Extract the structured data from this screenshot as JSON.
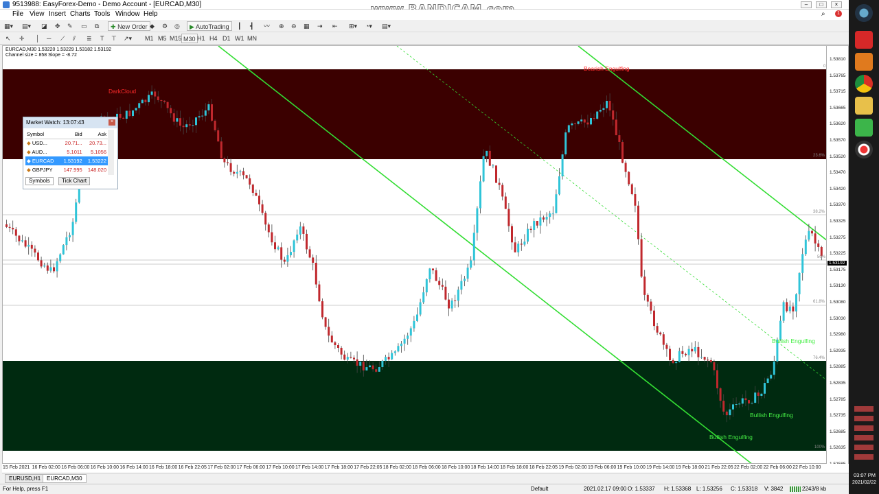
{
  "window": {
    "title": "9513988: EasyForex-Demo - Demo Account - [EURCAD,M30]",
    "watermark": "www.BANDICAM.com"
  },
  "menu": [
    "File",
    "View",
    "Insert",
    "Charts",
    "Tools",
    "Window",
    "Help"
  ],
  "toolbar": {
    "new_order": "New Order",
    "autotrading": "AutoTrading",
    "timeframes": [
      "M1",
      "M5",
      "M15",
      "M30",
      "H1",
      "H4",
      "D1",
      "W1",
      "MN"
    ]
  },
  "chart": {
    "header_line1": "EURCAD,M30  1.53220 1.53229 1.53182 1.53192",
    "header_line2": "Channel size = 858 Slope = -8.72",
    "price_labels": [
      "1.53810",
      "1.53765",
      "1.53715",
      "1.53665",
      "1.53620",
      "1.53570",
      "1.53520",
      "1.53470",
      "1.53420",
      "1.53370",
      "1.53325",
      "1.53275",
      "1.53225",
      "1.53175",
      "1.53130",
      "1.53080",
      "1.53030",
      "1.52980",
      "1.52935",
      "1.52885",
      "1.52835",
      "1.52785",
      "1.52735",
      "1.52685",
      "1.52635",
      "1.52585"
    ],
    "current_price": "1.53192",
    "fib_labels": {
      "f0": "0",
      "f236": "23.6%",
      "f382": "38.2%",
      "f50": "50%",
      "f618": "61.8%",
      "f764": "76.4%",
      "f100": "100%"
    },
    "time_labels": [
      "15 Feb 2021",
      "16 Feb 02:00",
      "16 Feb 06:00",
      "16 Feb 10:00",
      "16 Feb 14:00",
      "16 Feb 18:00",
      "16 Feb 22:05",
      "17 Feb 02:00",
      "17 Feb 06:00",
      "17 Feb 10:00",
      "17 Feb 14:00",
      "17 Feb 18:00",
      "17 Feb 22:05",
      "18 Feb 02:00",
      "18 Feb 06:00",
      "18 Feb 10:00",
      "18 Feb 14:00",
      "18 Feb 18:00",
      "18 Feb 22:05",
      "19 Feb 02:00",
      "19 Feb 06:00",
      "19 Feb 10:00",
      "19 Feb 14:00",
      "19 Feb 18:00",
      "21 Feb 22:05",
      "22 Feb 02:00",
      "22 Feb 06:00",
      "22 Feb 10:00"
    ],
    "annotations": {
      "dark_cloud": "DarkCloud",
      "bearish": "Bearish Engulfing",
      "bullish1": "Bullish Engulfing",
      "bullish2": "Bullish Engulfing",
      "bullish3": "Bullish Engulfing"
    },
    "colors": {
      "bull": "#2fc4d8",
      "bear": "#c0282d",
      "supply_zone": "#3b0000",
      "demand_zone": "#002a10",
      "channel": "#33dd33"
    }
  },
  "market_watch": {
    "title": "Market Watch: 13:07:43",
    "columns": [
      "Symbol",
      "Bid",
      "Ask"
    ],
    "rows": [
      {
        "symbol": "USD...",
        "bid": "20.71...",
        "ask": "20.73..."
      },
      {
        "symbol": "AUD...",
        "bid": "5.1011",
        "ask": "5.1056"
      },
      {
        "symbol": "EURCAD",
        "bid": "1.53192",
        "ask": "1.53222"
      },
      {
        "symbol": "GBPJPY",
        "bid": "147.995",
        "ask": "148.020"
      }
    ],
    "tabs": [
      "Symbols",
      "Tick Chart"
    ]
  },
  "chart_tabs": [
    "EURUSD,H1",
    "EURCAD,M30"
  ],
  "status": {
    "help": "For Help, press F1",
    "profile": "Default",
    "datetime": "2021.02.17 09:00",
    "open": "O: 1.53337",
    "high": "H: 1.53368",
    "low": "L: 1.53256",
    "close": "C: 1.53318",
    "volume": "V: 3842",
    "traffic": "2243/8 kb"
  },
  "clock": {
    "time": "03:07 PM",
    "date": "2021/02/22"
  }
}
